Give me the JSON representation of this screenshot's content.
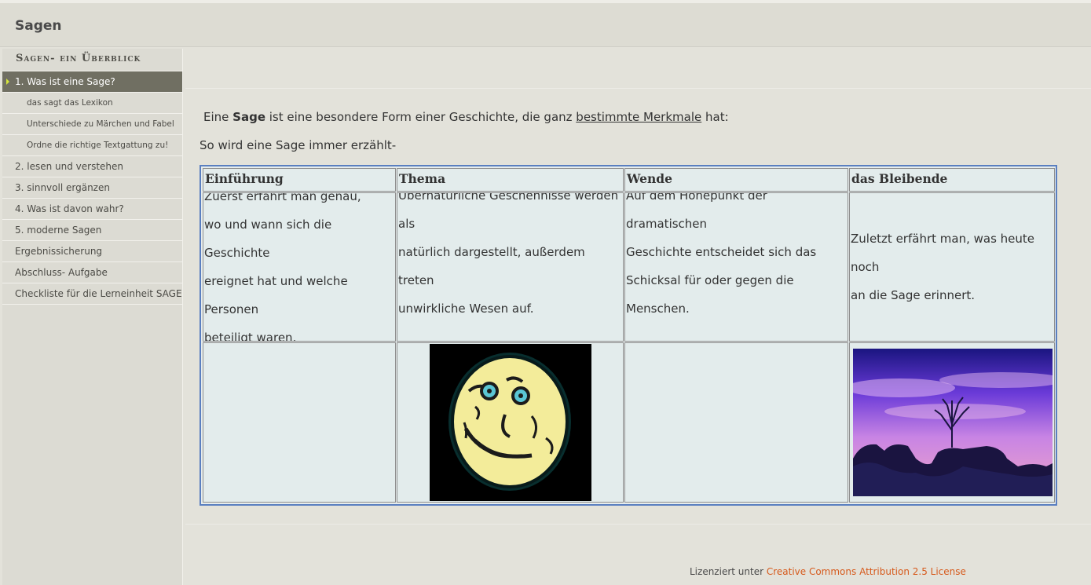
{
  "header": {
    "title": "Sagen"
  },
  "sidebar": {
    "heading": "Sagen- ein Überblick",
    "items": [
      {
        "label": "1. Was ist eine Sage?",
        "active": true
      },
      {
        "label": "das sagt das Lexikon",
        "sub": true
      },
      {
        "label": "Unterschiede zu Märchen und Fabel",
        "sub": true
      },
      {
        "label": "Ordne die richtige Textgattung zu!",
        "sub": true
      },
      {
        "label": "2. lesen und verstehen"
      },
      {
        "label": "3. sinnvoll ergänzen"
      },
      {
        "label": "4. Was ist davon wahr?"
      },
      {
        "label": "5. moderne Sagen"
      },
      {
        "label": "Ergebnissicherung"
      },
      {
        "label": "Abschluss- Aufgabe"
      },
      {
        "label": "Checkliste für die Lerneinheit SAGE"
      }
    ]
  },
  "content": {
    "intro_pre": "Eine ",
    "intro_bold": "Sage",
    "intro_mid": " ist eine besondere Form einer Geschichte, die ganz ",
    "intro_link": "bestimmte Merkmale",
    "intro_post": " hat:",
    "sub": "So wird eine Sage immer erzählt-",
    "table": {
      "headers": [
        "Einführung",
        "Thema",
        "Wende",
        "das Bleibende"
      ],
      "cells": [
        [
          "Zuerst erfährt man genau,",
          "wo und wann sich die Geschichte",
          "ereignet hat und welche Personen",
          "beteiligt waren."
        ],
        [
          "Übernatürliche Geschehnisse werden als",
          "natürlich dargestellt, außerdem treten",
          "unwirkliche Wesen auf."
        ],
        [
          "Auf dem Höhepunkt der dramatischen",
          "Geschichte entscheidet sich das",
          "Schicksal für oder gegen die Menschen."
        ],
        [
          "Zuletzt erfährt man, was heute noch",
          "an die Sage erinnert."
        ]
      ],
      "images": [
        "smiling-moon-face",
        "tree-on-rock-sunset"
      ]
    }
  },
  "footer": {
    "prefix": "Lizenziert unter ",
    "link": "Creative Commons Attribution 2.5 License"
  },
  "colors": {
    "active_nav": "#706f62",
    "table_border": "#5a7fc0",
    "footer_link": "#d65a1c"
  }
}
